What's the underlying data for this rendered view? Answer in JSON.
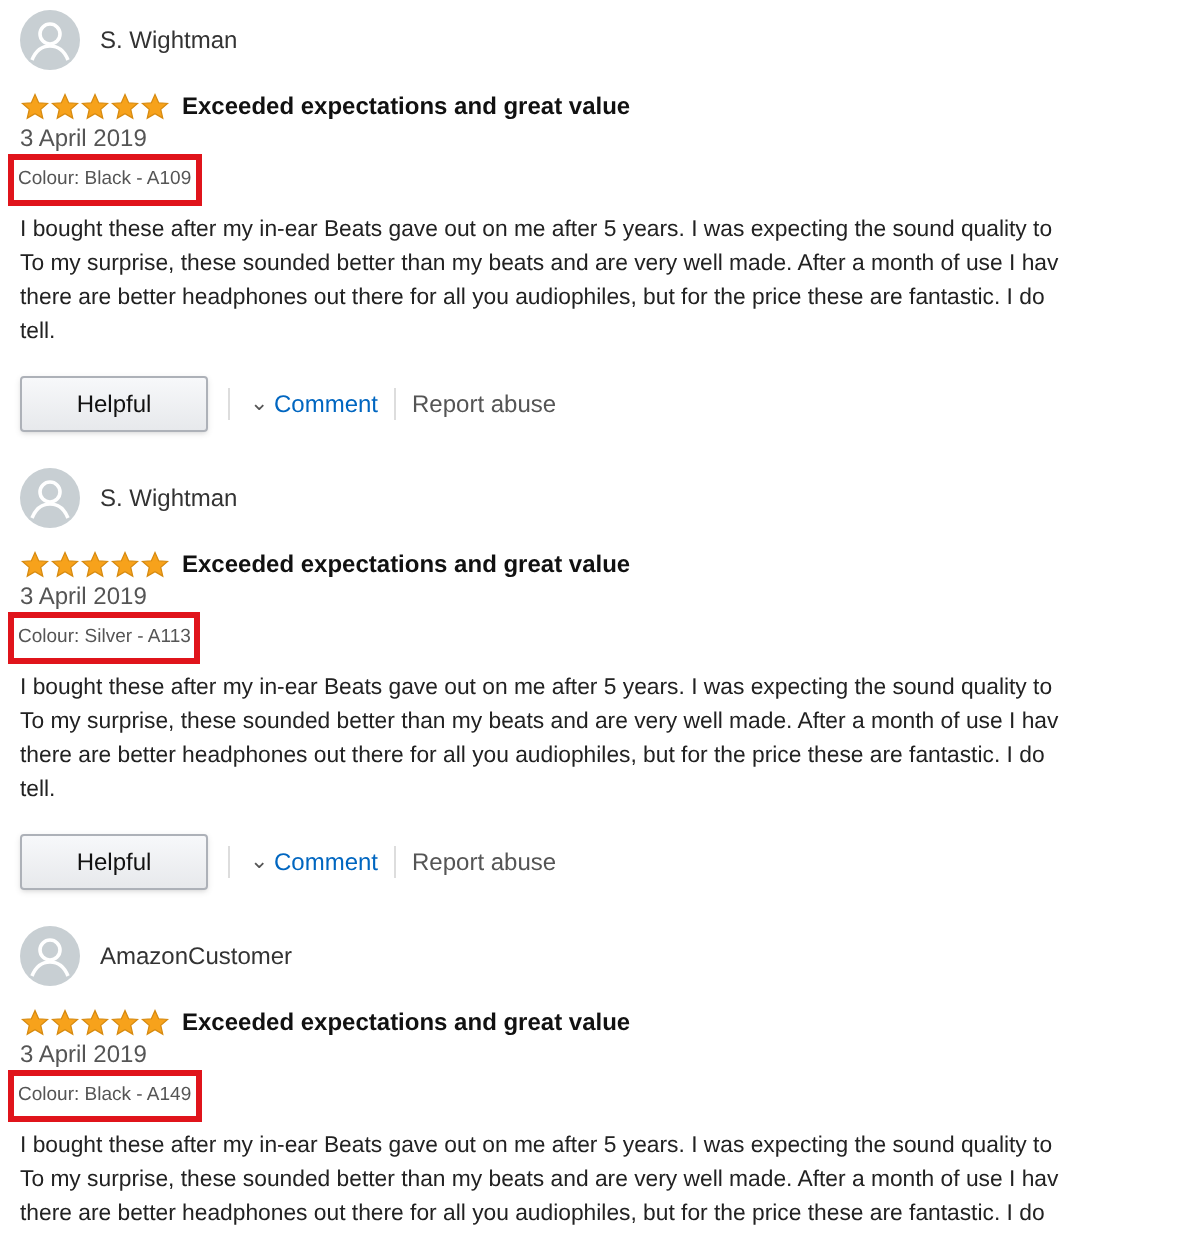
{
  "reviews": [
    {
      "author": "S. Wightman",
      "stars": 5,
      "title": "Exceeded expectations and great value",
      "date": "3 April 2019",
      "variant": "Colour: Black - A109",
      "highlighted": true,
      "lines": [
        "I bought these after my in-ear Beats gave out on me after 5 years. I was expecting the sound quality to",
        "To my surprise, these sounded better than my beats and are very well made. After a month of use I hav",
        "there are better headphones out there for all you audiophiles, but for the price these are fantastic. I do",
        "tell."
      ],
      "actions": {
        "helpful": "Helpful",
        "caret": "⌄",
        "comment": "Comment",
        "report": "Report abuse"
      }
    },
    {
      "author": "S. Wightman",
      "stars": 5,
      "title": "Exceeded expectations and great value",
      "date": "3 April 2019",
      "variant": "Colour: Silver - A113",
      "highlighted": true,
      "lines": [
        "I bought these after my in-ear Beats gave out on me after 5 years. I was expecting the sound quality to",
        "To my surprise, these sounded better than my beats and are very well made. After a month of use I hav",
        "there are better headphones out there for all you audiophiles, but for the price these are fantastic. I do",
        "tell."
      ],
      "actions": {
        "helpful": "Helpful",
        "caret": "⌄",
        "comment": "Comment",
        "report": "Report abuse"
      }
    },
    {
      "author": "AmazonCustomer",
      "stars": 5,
      "title": "Exceeded expectations and great value",
      "date": "3 April 2019",
      "variant": "Colour: Black - A149",
      "highlighted": true,
      "lines": [
        "I bought these after my in-ear Beats gave out on me after 5 years. I was expecting the sound quality to",
        "To my surprise, these sounded better than my beats and are very well made. After a month of use I hav",
        "there are better headphones out there for all you audiophiles, but for the price these are fantastic. I do"
      ]
    }
  ]
}
